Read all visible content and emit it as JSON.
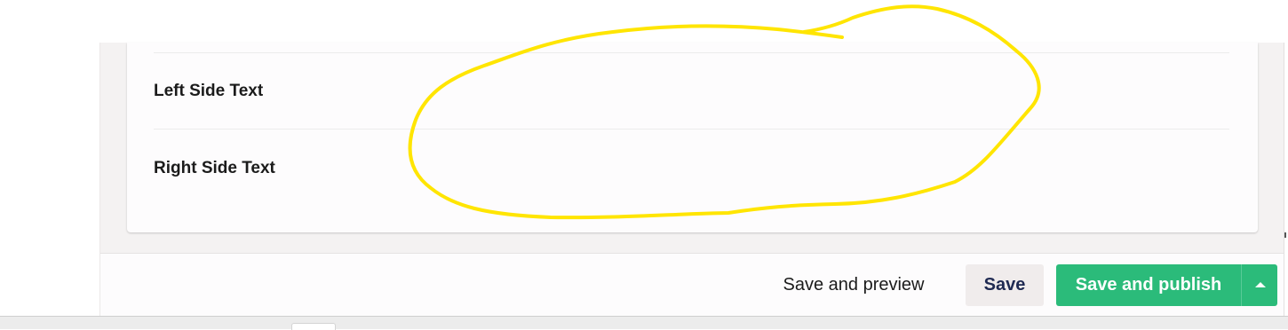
{
  "content_panel": {
    "properties": [
      {
        "label": "Left Side Text"
      },
      {
        "label": "Right Side Text"
      }
    ]
  },
  "footer": {
    "save_and_preview_label": "Save and preview",
    "save_label": "Save",
    "save_and_publish_label": "Save and publish",
    "publish_options_icon": "caret-up-icon"
  },
  "annotation": {
    "shape": "hand-drawn-ellipse",
    "color": "#ffe500"
  },
  "colors": {
    "publish_button": "#2bbb7a",
    "save_button_bg": "#f0ecec",
    "save_button_text": "#1f2a52",
    "workspace_bg": "#f4f2f2"
  }
}
